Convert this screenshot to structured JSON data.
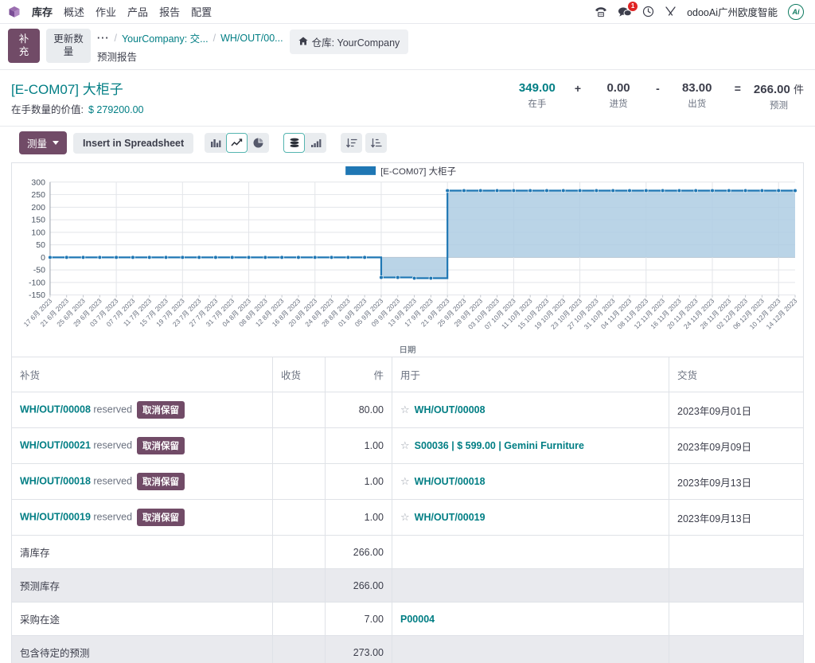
{
  "navbar": {
    "app_icon": "cube-icon",
    "app_name": "库存",
    "menus": [
      "概述",
      "作业",
      "产品",
      "报告",
      "配置"
    ],
    "icons": {
      "phone": "phone-icon",
      "messages": "messages-icon",
      "messages_badge": "1",
      "activities": "clock-icon",
      "tools": "tools-icon",
      "avatar_initials": "Ai"
    },
    "username": "odooAi广州欧度智能"
  },
  "control_panel": {
    "replenish_button": "补充",
    "update_qty_button": "更新数量",
    "breadcrumb": {
      "dots": "···",
      "items": [
        "YourCompany: 交...",
        "WH/OUT/00..."
      ],
      "current": "预测报告"
    },
    "warehouse_pill": {
      "icon": "home-icon",
      "label": "仓库: YourCompany"
    }
  },
  "title_block": {
    "product": "[E-COM07] 大柜子",
    "value_label": "在手数量的价值:",
    "value_amount": "$ 279200.00",
    "stats": [
      {
        "num": "349.00",
        "label": "在手",
        "op": ""
      },
      {
        "num": "0.00",
        "label": "进货",
        "op": "+"
      },
      {
        "num": "83.00",
        "label": "出货",
        "op": "-"
      },
      {
        "num": "266.00",
        "label": "预测",
        "op": "=",
        "unit": "件"
      }
    ]
  },
  "chart_toolbar": {
    "measure_label": "测量",
    "spreadsheet_label": "Insert in Spreadsheet",
    "icons": [
      {
        "name": "bar-chart-icon",
        "active": false
      },
      {
        "name": "line-chart-icon",
        "active": true
      },
      {
        "name": "pie-chart-icon",
        "active": false
      },
      {
        "name": "stacked-icon",
        "active": true
      },
      {
        "name": "descending-bars-icon",
        "active": false
      },
      {
        "name": "sort-descending-icon",
        "active": false
      },
      {
        "name": "sort-ascending-icon",
        "active": false
      }
    ]
  },
  "chart_data": {
    "type": "area",
    "title": "",
    "legend": "[E-COM07] 大柜子",
    "legend_position": "top-center",
    "legend_color": "#1f77b4",
    "xlabel": "日期",
    "ylabel": "",
    "grid": true,
    "ylim": [
      -150,
      300
    ],
    "yticks": [
      -150,
      -100,
      -50,
      0,
      50,
      100,
      150,
      200,
      250,
      300
    ],
    "xtick_labels": [
      "17 6月 2023",
      "21 6月 2023",
      "25 6月 2023",
      "29 6月 2023",
      "03 7月 2023",
      "07 7月 2023",
      "11 7月 2023",
      "15 7月 2023",
      "19 7月 2023",
      "23 7月 2023",
      "27 7月 2023",
      "31 7月 2023",
      "04 8月 2023",
      "08 8月 2023",
      "12 8月 2023",
      "16 8月 2023",
      "20 8月 2023",
      "24 8月 2023",
      "28 8月 2023",
      "01 9月 2023",
      "05 9月 2023",
      "09 9月 2023",
      "13 9月 2023",
      "17 9月 2023",
      "21 9月 2023",
      "25 9月 2023",
      "29 9月 2023",
      "03 10月 2023",
      "07 10月 2023",
      "11 10月 2023",
      "15 10月 2023",
      "19 10月 2023",
      "23 10月 2023",
      "27 10月 2023",
      "31 10月 2023",
      "04 11月 2023",
      "08 11月 2023",
      "12 11月 2023",
      "16 11月 2023",
      "20 11月 2023",
      "24 11月 2023",
      "28 11月 2023",
      "02 12月 2023",
      "06 12月 2023",
      "10 12月 2023",
      "14 12月 2023"
    ],
    "series": [
      {
        "name": "[E-COM07] 大柜子",
        "color": "#1f77b4",
        "fill": "#aecde3",
        "step_points": [
          {
            "x_index": 0,
            "value": 0
          },
          {
            "x_index": 19,
            "value": 0
          },
          {
            "x_index": 20,
            "value": -80
          },
          {
            "x_index": 22,
            "value": -83
          },
          {
            "x_index": 24,
            "value": 266
          },
          {
            "x_index": 45,
            "value": 266
          }
        ]
      }
    ]
  },
  "table": {
    "headers": [
      "补货",
      "收货",
      "件",
      "用于",
      "交货"
    ],
    "rows": [
      {
        "doc": "WH/OUT/00008",
        "doc_suffix": "reserved",
        "action": "取消保留",
        "receipt": "",
        "qty": "80.00",
        "used_star": true,
        "used": "WH/OUT/00008",
        "used_link": true,
        "delivery": "2023年09月01日",
        "alt": false
      },
      {
        "doc": "WH/OUT/00021",
        "doc_suffix": "reserved",
        "action": "取消保留",
        "receipt": "",
        "qty": "1.00",
        "used_star": true,
        "used": "S00036 | $ 599.00 | Gemini Furniture",
        "used_link": true,
        "delivery": "2023年09月09日",
        "alt": false
      },
      {
        "doc": "WH/OUT/00018",
        "doc_suffix": "reserved",
        "action": "取消保留",
        "receipt": "",
        "qty": "1.00",
        "used_star": true,
        "used": "WH/OUT/00018",
        "used_link": true,
        "delivery": "2023年09月13日",
        "alt": false
      },
      {
        "doc": "WH/OUT/00019",
        "doc_suffix": "reserved",
        "action": "取消保留",
        "receipt": "",
        "qty": "1.00",
        "used_star": true,
        "used": "WH/OUT/00019",
        "used_link": true,
        "delivery": "2023年09月13日",
        "alt": false
      },
      {
        "doc": "清库存",
        "doc_suffix": "",
        "action": "",
        "receipt": "",
        "qty": "266.00",
        "used_star": false,
        "used": "",
        "used_link": false,
        "delivery": "",
        "alt": false
      },
      {
        "doc": "预测库存",
        "doc_suffix": "",
        "action": "",
        "receipt": "",
        "qty": "266.00",
        "used_star": false,
        "used": "",
        "used_link": false,
        "delivery": "",
        "alt": true
      },
      {
        "doc": "采购在途",
        "doc_suffix": "",
        "action": "",
        "receipt": "",
        "qty": "7.00",
        "used_star": false,
        "used": "P00004",
        "used_link": true,
        "delivery": "",
        "alt": false
      },
      {
        "doc": "包含待定的预测",
        "doc_suffix": "",
        "action": "",
        "receipt": "",
        "qty": "273.00",
        "used_star": false,
        "used": "",
        "used_link": false,
        "delivery": "",
        "alt": true
      }
    ]
  },
  "colors": {
    "brand_purple": "#714b67",
    "link_teal": "#017e84",
    "series_blue": "#1f77b4",
    "series_fill": "#aecde3",
    "badge_red": "#e02424"
  }
}
